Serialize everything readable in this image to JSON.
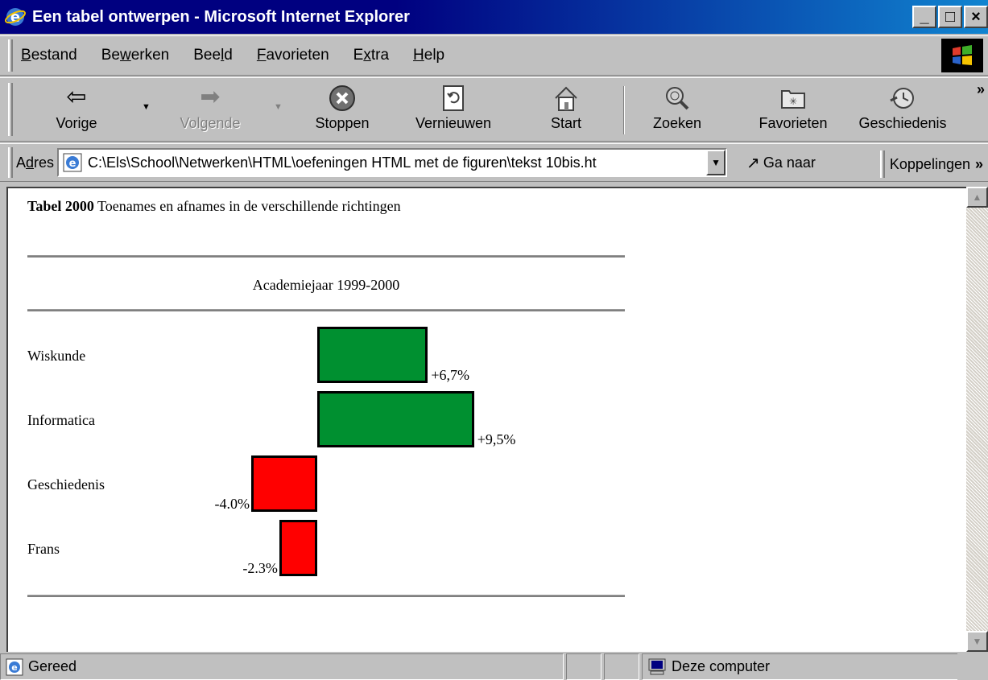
{
  "window": {
    "title": "Een tabel ontwerpen - Microsoft Internet Explorer",
    "minimize_symbol": "_",
    "maximize_symbol": "□",
    "close_symbol": "×"
  },
  "menu": {
    "items": [
      {
        "pre": "",
        "key": "B",
        "post": "estand"
      },
      {
        "pre": "Be",
        "key": "w",
        "post": "erken"
      },
      {
        "pre": "Bee",
        "key": "l",
        "post": "d"
      },
      {
        "pre": "",
        "key": "F",
        "post": "avorieten"
      },
      {
        "pre": "E",
        "key": "x",
        "post": "tra"
      },
      {
        "pre": "",
        "key": "H",
        "post": "elp"
      }
    ]
  },
  "toolbar": {
    "back": "Vorige",
    "forward": "Volgende",
    "stop": "Stoppen",
    "refresh": "Vernieuwen",
    "home": "Start",
    "search": "Zoeken",
    "favorites": "Favorieten",
    "history": "Geschiedenis",
    "more": "»"
  },
  "address": {
    "label_pre": "A",
    "label_key": "d",
    "label_post": "res",
    "url": "C:\\Els\\School\\Netwerken\\HTML\\oefeningen HTML met de figuren\\tekst 10bis.ht",
    "go": "Ga naar",
    "links": "Koppelingen",
    "links_more": "»"
  },
  "page": {
    "caption_bold": "Tabel 2000",
    "caption_text": " Toenames en afnames in de verschillende richtingen",
    "subheading": "Academiejaar 1999-2000"
  },
  "chart_data": {
    "type": "bar",
    "orientation": "horizontal-diverging",
    "title": "Tabel 2000 Toenames en afnames in de verschillende richtingen",
    "subtitle": "Academiejaar 1999-2000",
    "unit": "%",
    "categories": [
      "Wiskunde",
      "Informatica",
      "Geschiedenis",
      "Frans"
    ],
    "values": [
      6.7,
      9.5,
      -4.0,
      -2.3
    ],
    "labels": [
      "+6,7%",
      "+9,5%",
      "-4.0%",
      "-2.3%"
    ],
    "colors": {
      "positive": "#009030",
      "negative": "#ff0000"
    }
  },
  "status": {
    "text": "Gereed",
    "zone": "Deze computer"
  }
}
